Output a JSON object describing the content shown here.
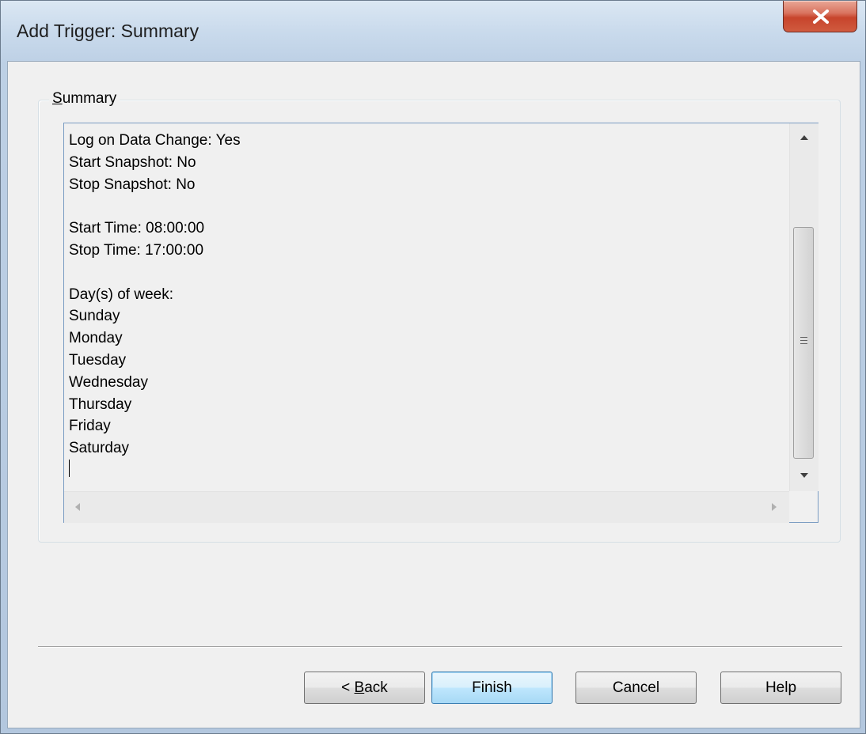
{
  "window": {
    "title": "Add Trigger: Summary",
    "close_icon": "close-x-icon"
  },
  "summary": {
    "label_mnemonic": "S",
    "label_rest": "ummary",
    "lines": [
      "Log on Data Change: Yes",
      "Start Snapshot: No",
      "Stop Snapshot: No",
      "",
      "Start Time: 08:00:00",
      "Stop Time: 17:00:00",
      "",
      "Day(s) of week:",
      "Sunday",
      "Monday",
      "Tuesday",
      "Wednesday",
      "Thursday",
      "Friday",
      "Saturday"
    ]
  },
  "buttons": {
    "back_prefix": "< ",
    "back_mnemonic": "B",
    "back_rest": "ack",
    "finish": "Finish",
    "cancel": "Cancel",
    "help": "Help"
  },
  "colors": {
    "default_button_border": "#3c7fb1",
    "close_button": "#c7442c"
  }
}
